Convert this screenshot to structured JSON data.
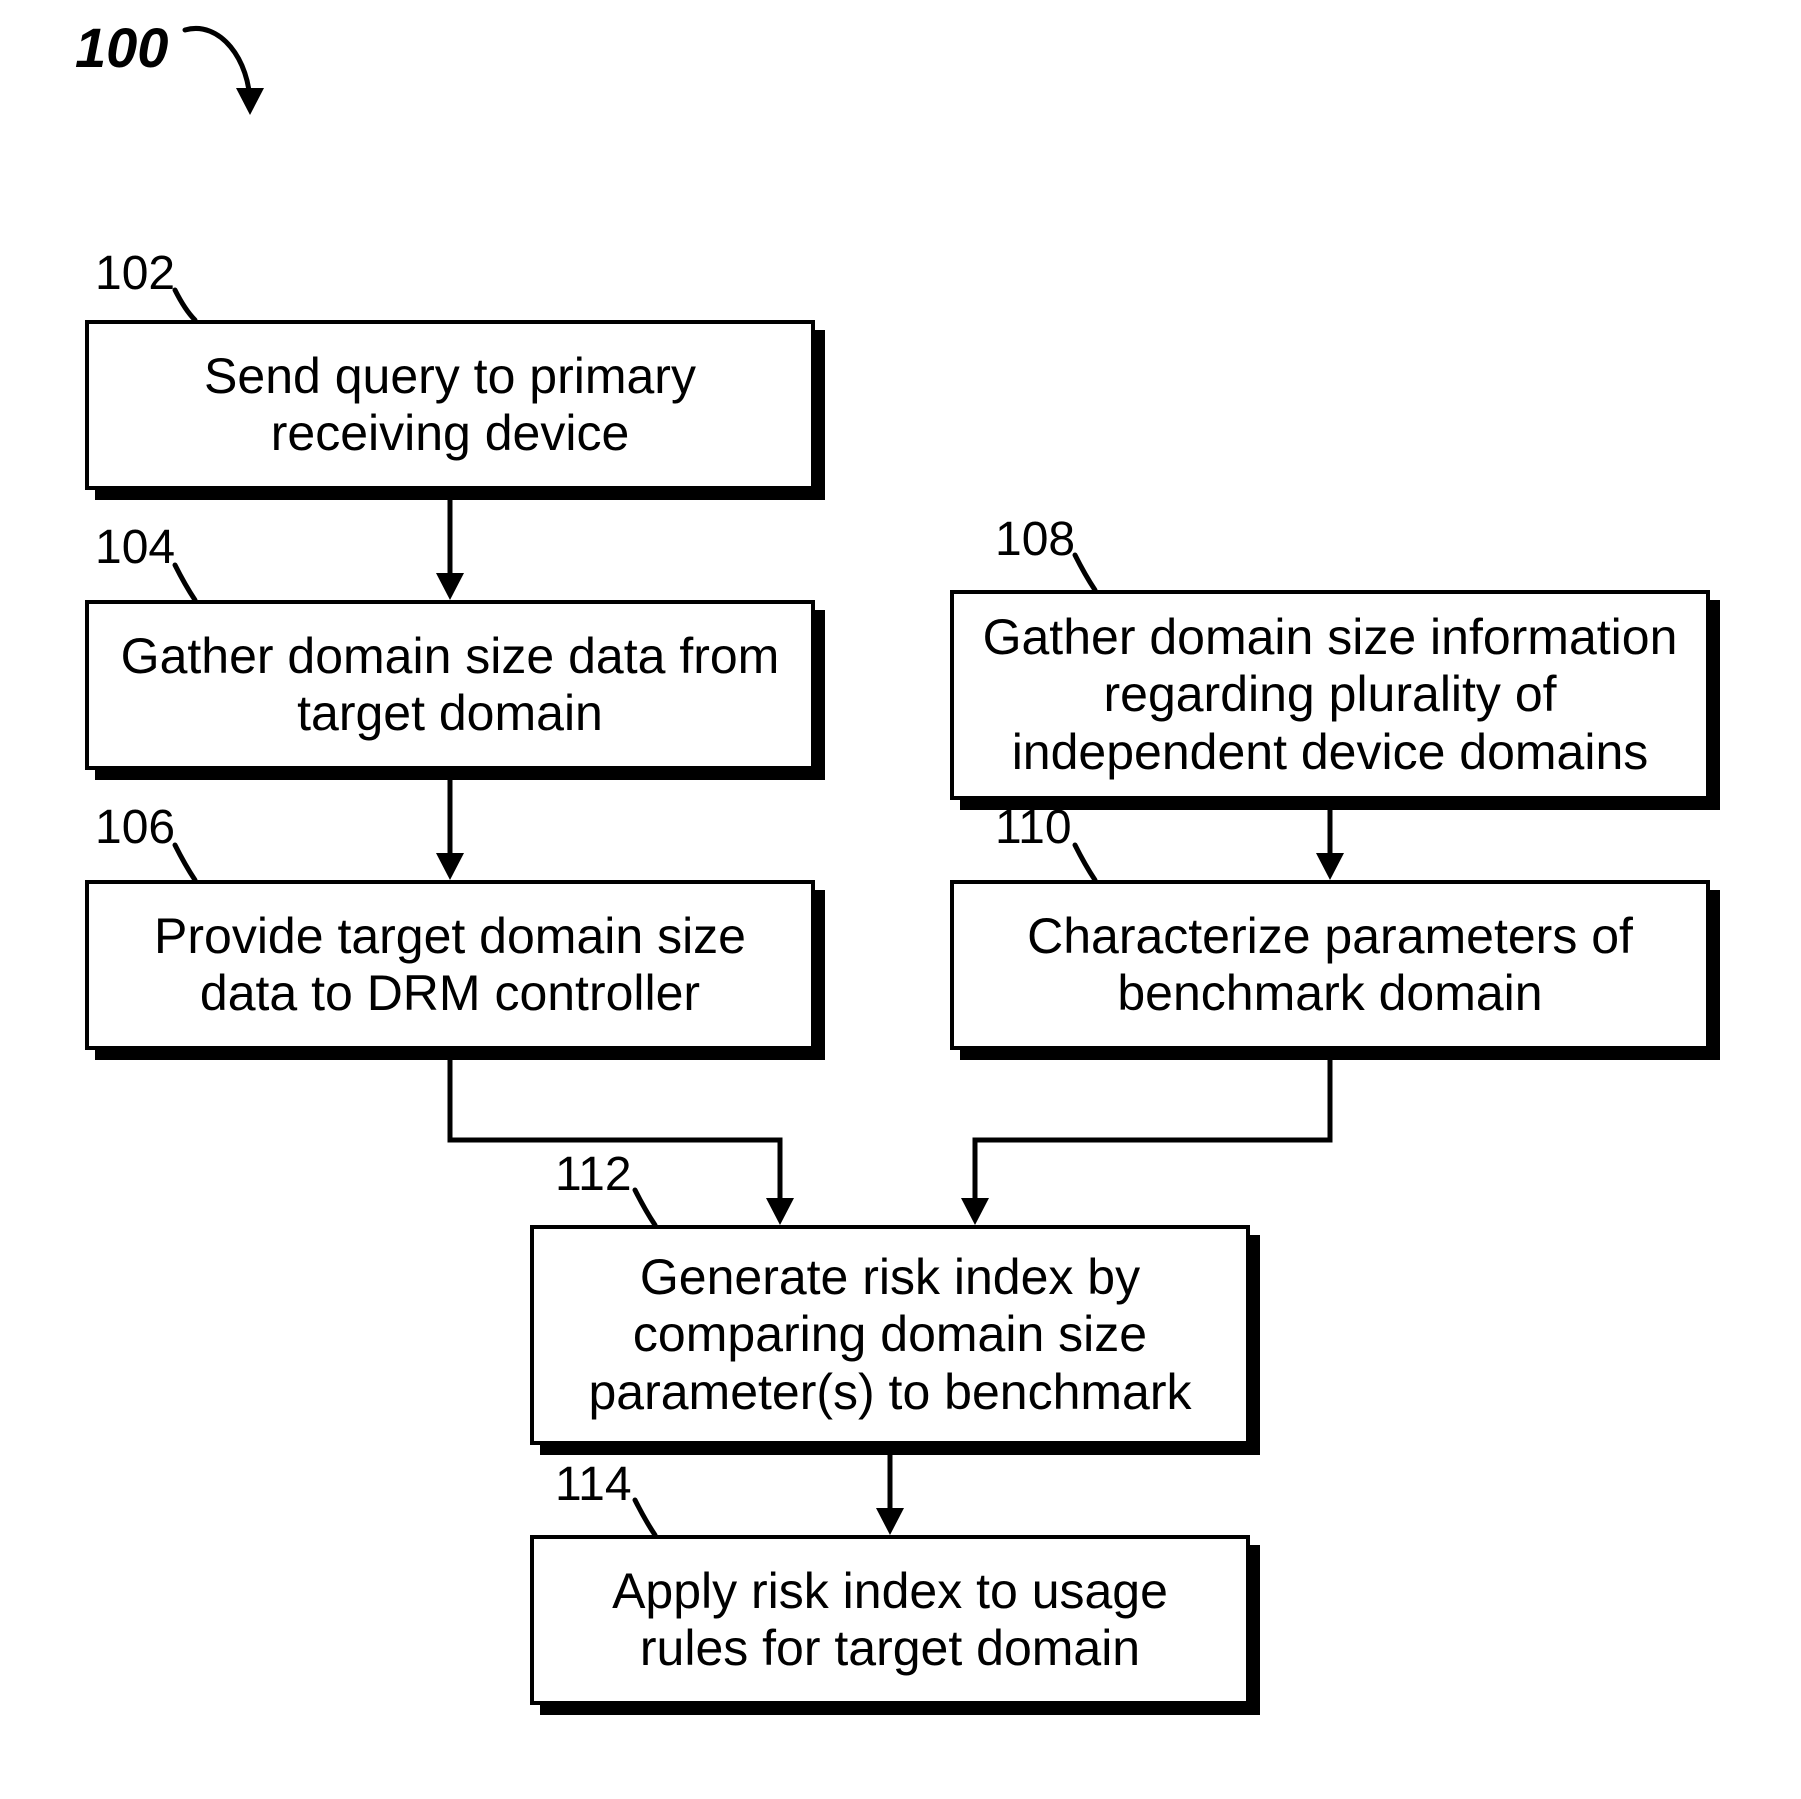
{
  "diagram": {
    "title_ref": "100",
    "boxes": {
      "b102": {
        "ref": "102",
        "text": "Send query to primary receiving device"
      },
      "b104": {
        "ref": "104",
        "text": "Gather domain size data from target domain"
      },
      "b106": {
        "ref": "106",
        "text": "Provide target domain size data to DRM controller"
      },
      "b108": {
        "ref": "108",
        "text": "Gather domain size information regarding plurality of independent device domains"
      },
      "b110": {
        "ref": "110",
        "text": "Characterize parameters of benchmark domain"
      },
      "b112": {
        "ref": "112",
        "text": "Generate risk index by comparing domain size parameter(s) to benchmark"
      },
      "b114": {
        "ref": "114",
        "text": "Apply risk index to usage rules for target domain"
      }
    }
  }
}
